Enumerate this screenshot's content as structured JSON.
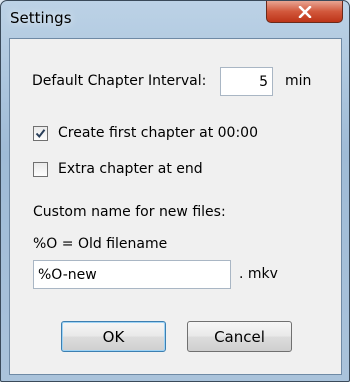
{
  "window": {
    "title": "Settings",
    "close_glyph": "close-icon"
  },
  "interval": {
    "label": "Default Chapter Interval:",
    "value": "5",
    "unit": "min"
  },
  "options": {
    "first_chapter": {
      "label": "Create first chapter at 00:00",
      "checked": true
    },
    "extra_chapter": {
      "label": "Extra chapter at end",
      "checked": false
    }
  },
  "naming": {
    "heading": "Custom name for new files:",
    "hint": "%O = Old filename",
    "value": "%O-new",
    "extension": ". mkv"
  },
  "buttons": {
    "ok": "OK",
    "cancel": "Cancel"
  },
  "colors": {
    "frame": "#a9c2da",
    "client": "#f0f0f0",
    "close_button": "#c9472a",
    "default_button_border": "#3c7fb1"
  }
}
